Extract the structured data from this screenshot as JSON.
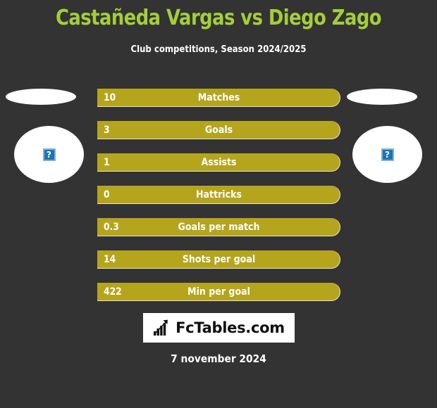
{
  "header": {
    "title": "Castañeda Vargas vs Diego Zago",
    "subtitle": "Club competitions, Season 2024/2025",
    "title_color": "#A4CE39",
    "subtitle_color": "#FFFFFF"
  },
  "background_color": "#333333",
  "bar_color": "#B5A51C",
  "players": {
    "left": {
      "name": "",
      "photo_placeholder": "broken-image-icon"
    },
    "right": {
      "name": "",
      "photo_placeholder": "broken-image-icon"
    }
  },
  "stats": [
    {
      "value": "10",
      "label": "Matches"
    },
    {
      "value": "3",
      "label": "Goals"
    },
    {
      "value": "1",
      "label": "Assists"
    },
    {
      "value": "0",
      "label": "Hattricks"
    },
    {
      "value": "0.3",
      "label": "Goals per match"
    },
    {
      "value": "14",
      "label": "Shots per goal"
    },
    {
      "value": "422",
      "label": "Min per goal"
    }
  ],
  "footer": {
    "logo_text": "FcTables.com",
    "logo_icon": "bar-chart-arrow-icon",
    "date": "7 november 2024"
  }
}
